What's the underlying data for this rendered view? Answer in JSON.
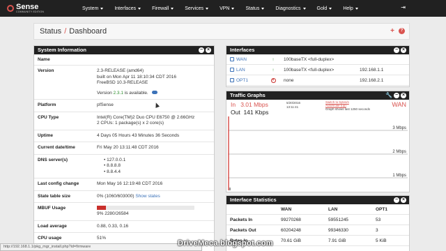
{
  "brand": {
    "name": "Sense",
    "sub": "COMMUNITY EDITION"
  },
  "nav": [
    {
      "label": "System"
    },
    {
      "label": "Interfaces"
    },
    {
      "label": "Firewall"
    },
    {
      "label": "Services"
    },
    {
      "label": "VPN"
    },
    {
      "label": "Status"
    },
    {
      "label": "Diagnostics"
    },
    {
      "label": "Gold"
    },
    {
      "label": "Help"
    }
  ],
  "breadcrumb": {
    "parent": "Status",
    "sep": "/",
    "current": "Dashboard"
  },
  "sysinfo": {
    "title": "System Information",
    "rows": {
      "name": {
        "label": "Name",
        "value": ""
      },
      "version": {
        "label": "Version",
        "line1": "2.3-RELEASE (amd64)",
        "line2": "built on Mon Apr 11 18:10:34 CDT 2016",
        "line3": "FreeBSD 10.3-RELEASE",
        "avail_pre": "Version ",
        "avail_ver": "2.3.1",
        "avail_post": " is available."
      },
      "platform": {
        "label": "Platform",
        "value": "pfSense"
      },
      "cpu": {
        "label": "CPU Type",
        "line1": "Intel(R) Core(TM)2 Duo CPU E6750 @ 2.66GHz",
        "line2": "2 CPUs: 1 package(s) x 2 core(s)"
      },
      "uptime": {
        "label": "Uptime",
        "value": "4 Days 05 Hours 43 Minutes 36 Seconds"
      },
      "datetime": {
        "label": "Current date/time",
        "value": "Fri May 20 13:11:48 CDT 2016"
      },
      "dns": {
        "label": "DNS server(s)",
        "servers": [
          "127.0.0.1",
          "8.8.8.8",
          "8.8.4.4"
        ]
      },
      "lastcfg": {
        "label": "Last config change",
        "value": "Mon May 16 12:19:48 CDT 2016"
      },
      "state": {
        "label": "State table size",
        "value": "0% (1060/603000)",
        "link": "Show states"
      },
      "mbuf": {
        "label": "MBUF Usage",
        "value": "9% 2280/26584",
        "fill": 0.09
      },
      "load": {
        "label": "Load average",
        "value": "0.88, 0.33, 0.16"
      },
      "cpuusage": {
        "label": "CPU usage",
        "value": "51%"
      }
    }
  },
  "interfaces": {
    "title": "Interfaces",
    "rows": [
      {
        "name": "WAN",
        "status": "up",
        "media": "100baseTX <full-duplex>",
        "ip": ""
      },
      {
        "name": "LAN",
        "status": "up",
        "media": "100baseTX <full-duplex>",
        "ip": "192.168.1.1"
      },
      {
        "name": "OPT1",
        "status": "down",
        "media": "none",
        "ip": "192.168.2.1"
      }
    ]
  },
  "traffic": {
    "title": "Traffic Graphs",
    "in_label": "In",
    "in_value": "3.01 Mbps",
    "out_label": "Out",
    "out_value": "141 Kbps",
    "date": "5/20/2016",
    "time": "13:11:41",
    "switch_link": "Switch to bytes/s",
    "autoscale_link": "AutoScale (up)",
    "note": "Graph shows last 1250 seconds",
    "iface": "WAN",
    "scale": [
      "3 Mbps",
      "2 Mbps",
      "1 Mbps"
    ]
  },
  "ifstats": {
    "title": "Interface Statistics",
    "columns": [
      "",
      "WAN",
      "LAN",
      "OPT1"
    ],
    "rows": [
      {
        "label": "Packets In",
        "values": [
          "99270268",
          "59551245",
          "53"
        ]
      },
      {
        "label": "Packets Out",
        "values": [
          "60204248",
          "99346330",
          "3"
        ]
      },
      {
        "label": "Bytes In",
        "values": [
          "70.61 GiB",
          "7.91 GiB",
          "5 KiB"
        ]
      }
    ]
  },
  "statusbar": {
    "url": "http://192.168.1.1/pkg_mgr_install.php?id=firmware"
  },
  "watermark": "DriveMeca.blogspot.com",
  "colors": {
    "accent": "#d9534f",
    "nav": "#212121",
    "link": "#3c72b8",
    "ok": "#2a8c2a"
  }
}
